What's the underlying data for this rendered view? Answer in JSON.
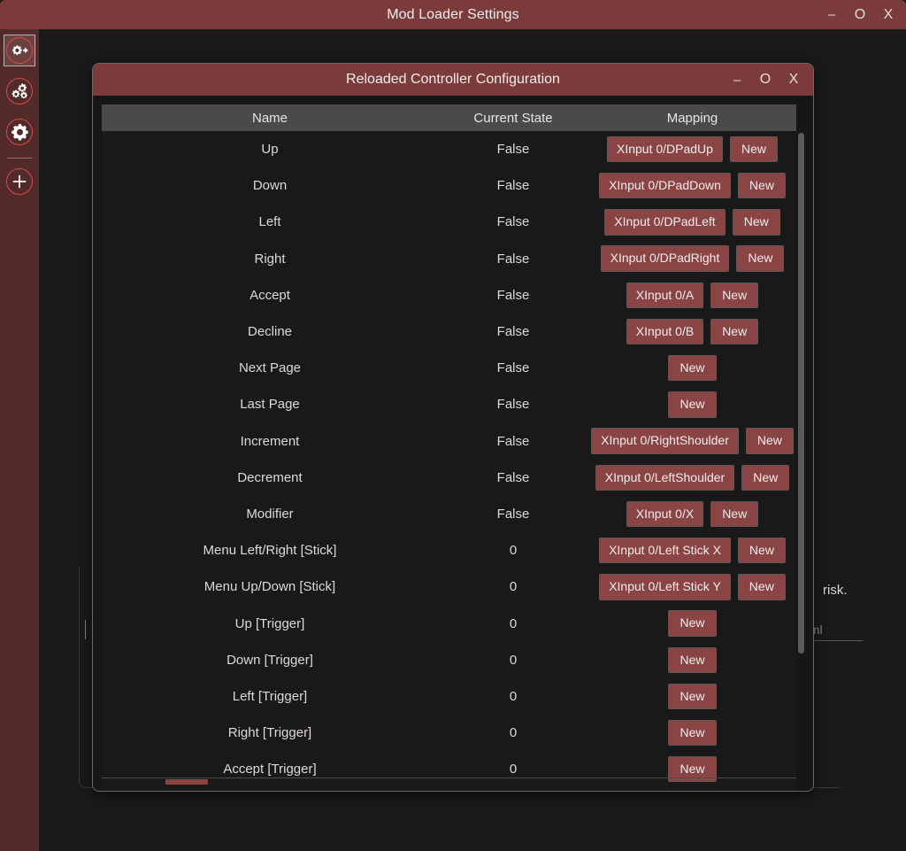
{
  "main_window": {
    "title": "Mod Loader Settings",
    "controls": [
      {
        "name": "minimize",
        "glyph": "–"
      },
      {
        "name": "maximize",
        "glyph": "O"
      },
      {
        "name": "close",
        "glyph": "X"
      }
    ]
  },
  "sidebar": {
    "items": [
      {
        "icon": "gear-plus-icon",
        "selected": true
      },
      {
        "icon": "multiple-gears-icon",
        "selected": false
      },
      {
        "icon": "gear-icon",
        "selected": false
      },
      {
        "icon": "plus-icon",
        "selected": false
      }
    ]
  },
  "background": {
    "notice_fragment": "risk.",
    "input_value": "aml"
  },
  "dialog": {
    "title": "Reloaded Controller Configuration",
    "controls": [
      {
        "name": "minimize",
        "glyph": "–"
      },
      {
        "name": "maximize",
        "glyph": "O"
      },
      {
        "name": "close",
        "glyph": "X"
      }
    ],
    "table": {
      "columns": [
        "Name",
        "Current State",
        "Mapping"
      ],
      "new_button_label": "New",
      "rows": [
        {
          "name": "Up",
          "state": "False",
          "mapping": "XInput 0/DPadUp"
        },
        {
          "name": "Down",
          "state": "False",
          "mapping": "XInput 0/DPadDown"
        },
        {
          "name": "Left",
          "state": "False",
          "mapping": "XInput 0/DPadLeft"
        },
        {
          "name": "Right",
          "state": "False",
          "mapping": "XInput 0/DPadRight"
        },
        {
          "name": "Accept",
          "state": "False",
          "mapping": "XInput 0/A"
        },
        {
          "name": "Decline",
          "state": "False",
          "mapping": "XInput 0/B"
        },
        {
          "name": "Next Page",
          "state": "False",
          "mapping": ""
        },
        {
          "name": "Last Page",
          "state": "False",
          "mapping": ""
        },
        {
          "name": "Increment",
          "state": "False",
          "mapping": "XInput 0/RightShoulder"
        },
        {
          "name": "Decrement",
          "state": "False",
          "mapping": "XInput 0/LeftShoulder"
        },
        {
          "name": "Modifier",
          "state": "False",
          "mapping": "XInput 0/X"
        },
        {
          "name": "Menu Left/Right [Stick]",
          "state": "0",
          "mapping": "XInput 0/Left Stick X"
        },
        {
          "name": "Menu Up/Down [Stick]",
          "state": "0",
          "mapping": "XInput 0/Left Stick Y"
        },
        {
          "name": "Up [Trigger]",
          "state": "0",
          "mapping": ""
        },
        {
          "name": "Down [Trigger]",
          "state": "0",
          "mapping": ""
        },
        {
          "name": "Left [Trigger]",
          "state": "0",
          "mapping": ""
        },
        {
          "name": "Right [Trigger]",
          "state": "0",
          "mapping": ""
        },
        {
          "name": "Accept [Trigger]",
          "state": "0",
          "mapping": ""
        }
      ]
    }
  },
  "colors": {
    "titlebar": "#7b3b3b",
    "sidebar": "#522a2a",
    "accent_red": "#d94a4a",
    "button": "#8a4444",
    "table_header": "#4a4a4a",
    "table_body": "#191919",
    "window_bg": "#1a1a1a"
  }
}
